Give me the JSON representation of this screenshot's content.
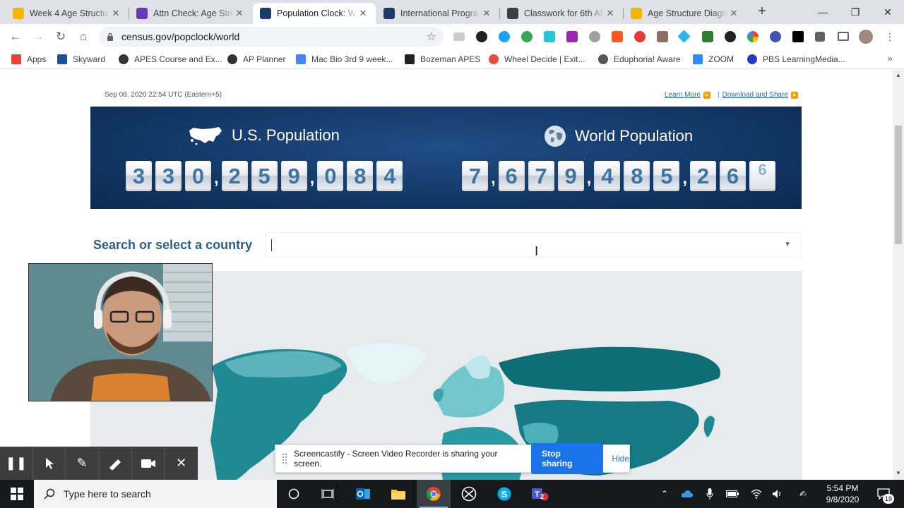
{
  "browser": {
    "tabs": [
      {
        "title": "Week 4 Age Structu",
        "favicon": "google-slides-icon",
        "color": "#f4b400",
        "active": false
      },
      {
        "title": "Attn Check: Age Stru",
        "favicon": "google-forms-icon",
        "color": "#673ab7",
        "active": false
      },
      {
        "title": "Population Clock: W",
        "favicon": "census-bureau-icon",
        "color": "#1d3b6a",
        "active": true
      },
      {
        "title": "International Progra",
        "favicon": "census-bureau-icon",
        "color": "#1d3b6a",
        "active": false
      },
      {
        "title": "Classwork for 6th AP",
        "favicon": "google-classroom-icon",
        "color": "#3c4043",
        "active": false
      },
      {
        "title": "Age Structure Diagra",
        "favicon": "google-slides-icon",
        "color": "#f4b400",
        "active": false
      }
    ],
    "url": "census.gov/popclock/world",
    "bookmarks": [
      {
        "label": "Apps",
        "icon": "apps-grid-icon",
        "color": "#ea4335"
      },
      {
        "label": "Skyward",
        "icon": "skyward-icon",
        "color": "#1e4f9c"
      },
      {
        "label": "APES Course and Ex...",
        "icon": "college-board-icon",
        "color": "#333333"
      },
      {
        "label": "AP Planner",
        "icon": "college-board-icon",
        "color": "#333333"
      },
      {
        "label": "Mac Bio 3rd 9 week...",
        "icon": "google-docs-icon",
        "color": "#4285f4"
      },
      {
        "label": "Bozeman APES",
        "icon": "bozeman-icon",
        "color": "#222222"
      },
      {
        "label": "Wheel Decide | Exit...",
        "icon": "wheel-icon",
        "color": "#e94e3c"
      },
      {
        "label": "Eduphoria! Aware",
        "icon": "globe-icon",
        "color": "#555555"
      },
      {
        "label": "ZOOM",
        "icon": "zoom-icon",
        "color": "#2d8cff"
      },
      {
        "label": "PBS LearningMedia...",
        "icon": "pbs-icon",
        "color": "#2638c4"
      }
    ],
    "bookmarks_more": "»"
  },
  "page": {
    "datetime": "Sep 08, 2020 22:54 UTC (Eastern+5)",
    "learn_more": "Learn More",
    "separator": "|",
    "download_share": "Download and Share",
    "us": {
      "label": "U.S. Population",
      "digits": [
        "3",
        "3",
        "0",
        ",",
        "2",
        "5",
        "9",
        ",",
        "0",
        "8",
        "4"
      ]
    },
    "world": {
      "label": "World Population",
      "digits": [
        "7",
        ",",
        "6",
        "7",
        "9",
        ",",
        "4",
        "8",
        "5",
        ",",
        "2",
        "6",
        "6"
      ]
    },
    "search_label": "Search or select a country",
    "search_value": ""
  },
  "screencastify": {
    "message": "Screencastify - Screen Video Recorder is sharing your screen.",
    "stop_label": "Stop sharing",
    "hide_label": "Hide"
  },
  "taskbar": {
    "search_placeholder": "Type here to search",
    "time": "5:54 PM",
    "date": "9/8/2020",
    "notifications": "19",
    "teams_badge": "2"
  }
}
